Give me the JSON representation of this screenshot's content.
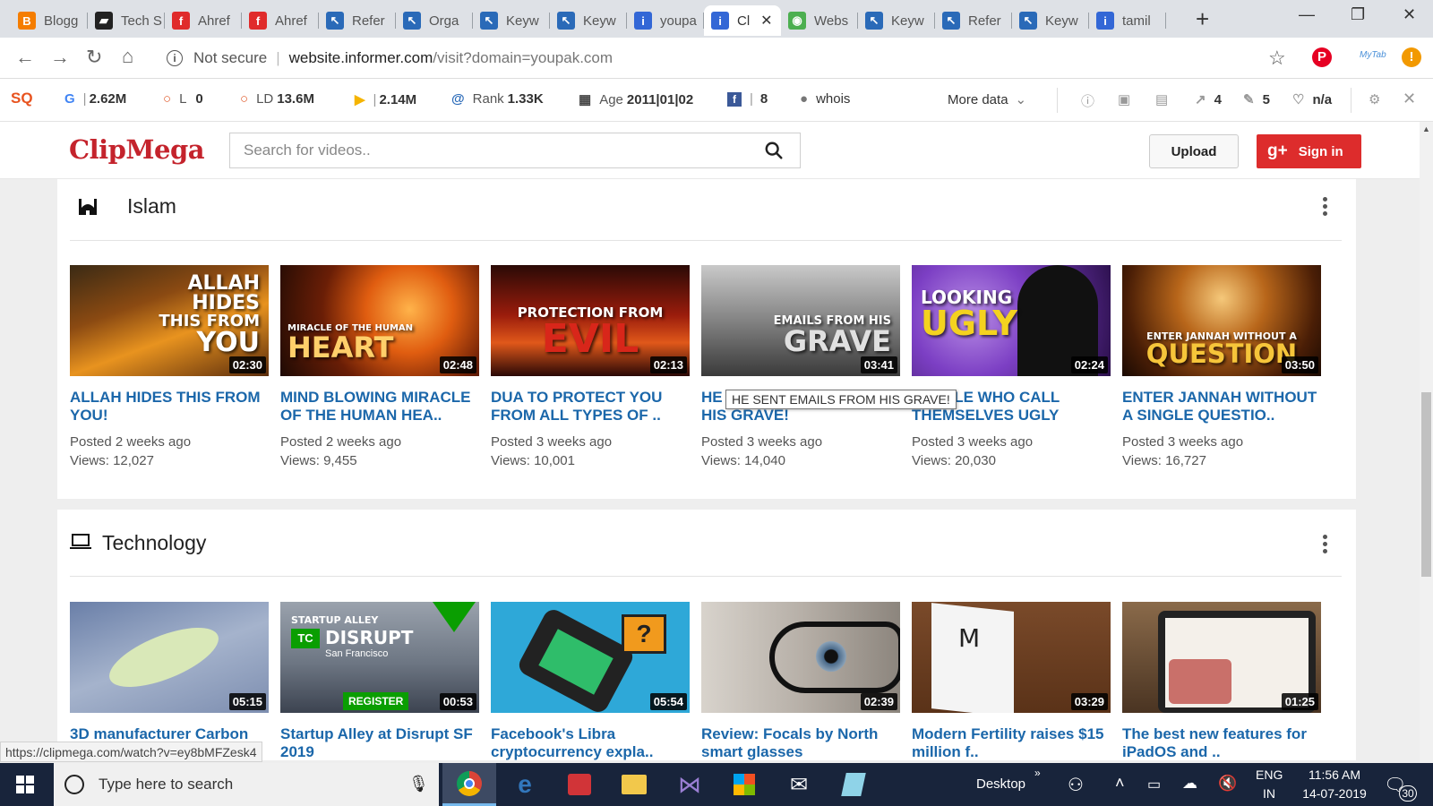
{
  "browser": {
    "tabs": [
      {
        "title": "Blogg",
        "icon": "blogger-icon",
        "color": "#f57d00",
        "glyph": "B"
      },
      {
        "title": "Tech S",
        "icon": "tech-icon",
        "color": "#222222",
        "glyph": "▰"
      },
      {
        "title": "Ahref",
        "icon": "ahrefs-icon",
        "color": "#e02b2b",
        "glyph": "f"
      },
      {
        "title": "Ahref",
        "icon": "ahrefs-icon",
        "color": "#e02b2b",
        "glyph": "f"
      },
      {
        "title": "Refer",
        "icon": "cursor-icon",
        "color": "#2a6ab8",
        "glyph": "↖"
      },
      {
        "title": "Orga",
        "icon": "cursor-icon",
        "color": "#2a6ab8",
        "glyph": "↖"
      },
      {
        "title": "Keyw",
        "icon": "cursor-icon",
        "color": "#2a6ab8",
        "glyph": "↖"
      },
      {
        "title": "Keyw",
        "icon": "cursor-icon",
        "color": "#2a6ab8",
        "glyph": "↖"
      },
      {
        "title": "youpa",
        "icon": "info-icon",
        "color": "#3367d6",
        "glyph": "i"
      },
      {
        "title": "Cl",
        "icon": "info-icon",
        "color": "#3367d6",
        "glyph": "i",
        "active": true
      },
      {
        "title": "Webs",
        "icon": "chrome-icon",
        "color": "#4caf50",
        "glyph": "◉"
      },
      {
        "title": "Keyw",
        "icon": "cursor-icon",
        "color": "#2a6ab8",
        "glyph": "↖"
      },
      {
        "title": "Refer",
        "icon": "cursor-icon",
        "color": "#2a6ab8",
        "glyph": "↖"
      },
      {
        "title": "Keyw",
        "icon": "cursor-icon",
        "color": "#2a6ab8",
        "glyph": "↖"
      },
      {
        "title": "tamil",
        "icon": "info-icon",
        "color": "#3367d6",
        "glyph": "i"
      }
    ],
    "not_secure": "Not secure",
    "url_host": "website.informer.com",
    "url_path": "/visit?domain=youpak.com",
    "status_url": "https://clipmega.com/watch?v=ey8bMFZesk4"
  },
  "seo_toolbar": {
    "google": "2.62M",
    "l_label": "L",
    "l_value": "0",
    "ld_label": "LD",
    "ld_value": "13.6M",
    "bing": "2.14M",
    "rank_label": "Rank",
    "rank_value": "1.33K",
    "age_label": "Age",
    "age_value": "2011|01|02",
    "facebook": "8",
    "whois": "whois",
    "more_data": "More data",
    "ext_links": "4",
    "int_links": "5",
    "health": "n/a"
  },
  "site": {
    "logo": "ClipMega",
    "search_placeholder": "Search for videos..",
    "upload": "Upload",
    "signin": "Sign in"
  },
  "sections": [
    {
      "title": "Islam",
      "videos": [
        {
          "title": "ALLAH HIDES THIS FROM YOU!",
          "posted": "Posted 2 weeks ago",
          "views": "Views: 12,027",
          "duration": "02:30"
        },
        {
          "title": "MIND BLOWING MIRACLE OF THE HUMAN HEA..",
          "posted": "Posted 2 weeks ago",
          "views": "Views: 9,455",
          "duration": "02:48"
        },
        {
          "title": "DUA TO PROTECT YOU FROM ALL TYPES OF ..",
          "posted": "Posted 3 weeks ago",
          "views": "Views: 10,001",
          "duration": "02:13"
        },
        {
          "title": "HE SENT EMAILS FROM HIS GRAVE!",
          "posted": "Posted 3 weeks ago",
          "views": "Views: 14,040",
          "duration": "03:41"
        },
        {
          "title": "PEOPLE WHO CALL THEMSELVES UGLY",
          "posted": "Posted 3 weeks ago",
          "views": "Views: 20,030",
          "duration": "02:24"
        },
        {
          "title": "ENTER JANNAH WITHOUT A SINGLE QUESTIO..",
          "posted": "Posted 3 weeks ago",
          "views": "Views: 16,727",
          "duration": "03:50"
        }
      ]
    },
    {
      "title": "Technology",
      "videos": [
        {
          "title": "3D manufacturer Carbon",
          "duration": "05:15"
        },
        {
          "title": "Startup Alley at Disrupt SF 2019",
          "duration": "00:53"
        },
        {
          "title": "Facebook's Libra cryptocurrency expla..",
          "duration": "05:54"
        },
        {
          "title": "Review: Focals by North smart glasses",
          "duration": "02:39"
        },
        {
          "title": "Modern Fertility raises $15 million f..",
          "duration": "03:29"
        },
        {
          "title": "The best new features for iPadOS and ..",
          "duration": "01:25"
        }
      ]
    }
  ],
  "thumb_texts": {
    "t0a": "ALLAH",
    "t0b": "HIDES",
    "t0c": "THIS FROM",
    "t0d": "YOU",
    "t1a": "MIRACLE OF THE HUMAN",
    "t1b": "HEART",
    "t2a": "PROTECTION FROM",
    "t2b": "EVIL",
    "t3a": "EMAILS FROM HIS",
    "t3b": "GRAVE",
    "t4a": "LOOKING",
    "t4b": "UGLY",
    "t5a": "ENTER JANNAH WITHOUT A",
    "t5b": "QUESTION",
    "tc1a": "STARTUP ALLEY",
    "tc1b": "DISRUPT",
    "tc1c": "San Francisco",
    "tc1d": "REGISTER"
  },
  "tooltip": "HE SENT EMAILS FROM HIS GRAVE!",
  "taskbar": {
    "search_placeholder": "Type here to search",
    "desktop": "Desktop",
    "lang1": "ENG",
    "lang2": "IN",
    "time": "11:56 AM",
    "date": "14-07-2019",
    "notifications": "30"
  },
  "colors": {
    "brand_red": "#c4232c",
    "link_blue": "#1b67aa",
    "signin_red": "#dd2c2c"
  }
}
